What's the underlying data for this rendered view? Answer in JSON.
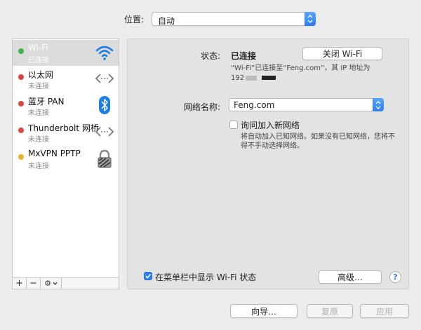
{
  "location": {
    "label": "位置:",
    "value": "自动"
  },
  "sidebar": {
    "items": [
      {
        "name": "Wi-Fi",
        "status": "已连接",
        "dot_color": "#3cb54a",
        "icon": "wifi-icon"
      },
      {
        "name": "以太网",
        "status": "未连接",
        "dot_color": "#e0443e",
        "icon": "ethernet-arrows-icon"
      },
      {
        "name": "蓝牙 PAN",
        "status": "未连接",
        "dot_color": "#e0443e",
        "icon": "bluetooth-icon"
      },
      {
        "name": "Thunderbolt 网桥",
        "status": "未连接",
        "dot_color": "#e0443e",
        "icon": "ethernet-arrows-icon"
      },
      {
        "name": "MxVPN PPTP",
        "status": "未连接",
        "dot_color": "#e8b526",
        "icon": "lock-icon"
      }
    ],
    "toolbar": {
      "add": "+",
      "remove": "−",
      "gear": "⚙"
    }
  },
  "detail": {
    "status_label": "状态:",
    "status_value": "已连接",
    "turn_off_button": "关闭 Wi-Fi",
    "status_desc": "“Wi-Fi”已连接至“Feng.com”，其 IP 地址为",
    "ip_prefix": "192",
    "network_name_label": "网络名称:",
    "network_name_value": "Feng.com",
    "ask_join_label": "询问加入新网络",
    "ask_join_desc_1": "将自动加入已知网络。如果没有已知网络，您将不",
    "ask_join_desc_2": "得不手动选择网络。",
    "show_menubar_label": "在菜单栏中显示 Wi-Fi 状态",
    "advanced_button": "高级…",
    "help_button": "?"
  },
  "footer": {
    "assist_button": "向导…",
    "revert_button": "复原",
    "apply_button": "应用"
  },
  "colors": {
    "accent": "#2d7ff0",
    "selected_row": "#dcdcdc"
  }
}
